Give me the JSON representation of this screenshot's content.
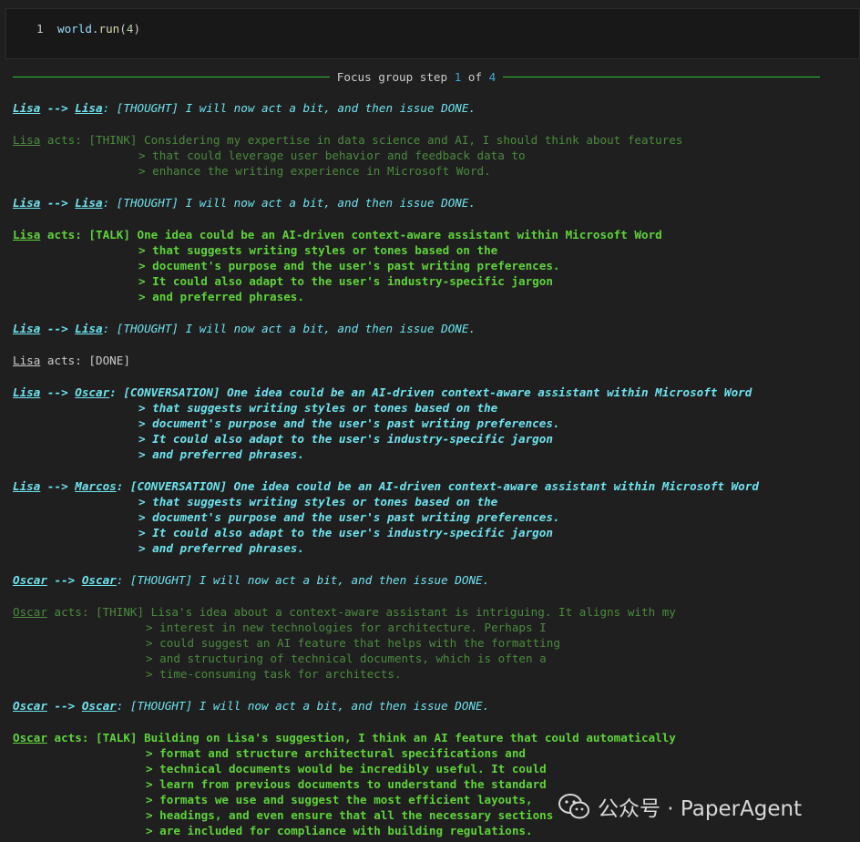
{
  "cell": {
    "line_number": "1",
    "code": {
      "obj": "world",
      "dot": ".",
      "fn": "run",
      "open": "(",
      "arg": "4",
      "close": ")"
    }
  },
  "step": {
    "prefix": "Focus group step ",
    "current": "1",
    "of": " of ",
    "total": "4"
  },
  "log": {
    "b1": {
      "from": "Lisa",
      "arrow": " --> ",
      "to": "Lisa",
      "msg": ": [THOUGHT] I will now act a bit, and then issue DONE."
    },
    "b2": {
      "name": "Lisa",
      "lines": [
        " acts: [THINK] Considering my expertise in data science and AI, I should think about features",
        "> that could leverage user behavior and feedback data to",
        "> enhance the writing experience in Microsoft Word."
      ]
    },
    "b3": {
      "from": "Lisa",
      "arrow": " --> ",
      "to": "Lisa",
      "msg": ": [THOUGHT] I will now act a bit, and then issue DONE."
    },
    "b4": {
      "name": "Lisa",
      "lines": [
        " acts: [TALK] One idea could be an AI-driven context-aware assistant within Microsoft Word",
        "> that suggests writing styles or tones based on the",
        "> document's purpose and the user's past writing preferences.",
        "> It could also adapt to the user's industry-specific jargon",
        "> and preferred phrases."
      ]
    },
    "b5": {
      "from": "Lisa",
      "arrow": " --> ",
      "to": "Lisa",
      "msg": ": [THOUGHT] I will now act a bit, and then issue DONE."
    },
    "b6": {
      "name": "Lisa",
      "msg": " acts: [DONE]"
    },
    "b7": {
      "from": "Lisa",
      "arrow": " --> ",
      "to": "Oscar",
      "lines": [
        ": [CONVERSATION] One idea could be an AI-driven context-aware assistant within Microsoft Word",
        "> that suggests writing styles or tones based on the",
        "> document's purpose and the user's past writing preferences.",
        "> It could also adapt to the user's industry-specific jargon",
        "> and preferred phrases."
      ]
    },
    "b8": {
      "from": "Lisa",
      "arrow": " --> ",
      "to": "Marcos",
      "lines": [
        ": [CONVERSATION] One idea could be an AI-driven context-aware assistant within Microsoft Word",
        "> that suggests writing styles or tones based on the",
        "> document's purpose and the user's past writing preferences.",
        "> It could also adapt to the user's industry-specific jargon",
        "> and preferred phrases."
      ]
    },
    "b9": {
      "from": "Oscar",
      "arrow": " --> ",
      "to": "Oscar",
      "msg": ": [THOUGHT] I will now act a bit, and then issue DONE."
    },
    "b10": {
      "name": "Oscar",
      "lines": [
        " acts: [THINK] Lisa's idea about a context-aware assistant is intriguing. It aligns with my",
        "> interest in new technologies for architecture. Perhaps I",
        "> could suggest an AI feature that helps with the formatting",
        "> and structuring of technical documents, which is often a",
        "> time-consuming task for architects."
      ]
    },
    "b11": {
      "from": "Oscar",
      "arrow": " --> ",
      "to": "Oscar",
      "msg": ": [THOUGHT] I will now act a bit, and then issue DONE."
    },
    "b12": {
      "name": "Oscar",
      "lines": [
        " acts: [TALK] Building on Lisa's suggestion, I think an AI feature that could automatically",
        "> format and structure architectural specifications and",
        "> technical documents would be incredibly useful. It could",
        "> learn from previous documents to understand the standard",
        "> formats we use and suggest the most efficient layouts,",
        "> headings, and even ensure that all the necessary sections",
        "> are included for compliance with building regulations."
      ]
    }
  },
  "watermark": {
    "icon": "wechat-icon",
    "text": "公众号 · PaperAgent"
  },
  "colors": {
    "thought": "#6ee3ee",
    "think": "#4b8a3e",
    "talk": "#5fd33a",
    "rule": "#33c233",
    "step_number": "#3fa9d4"
  }
}
